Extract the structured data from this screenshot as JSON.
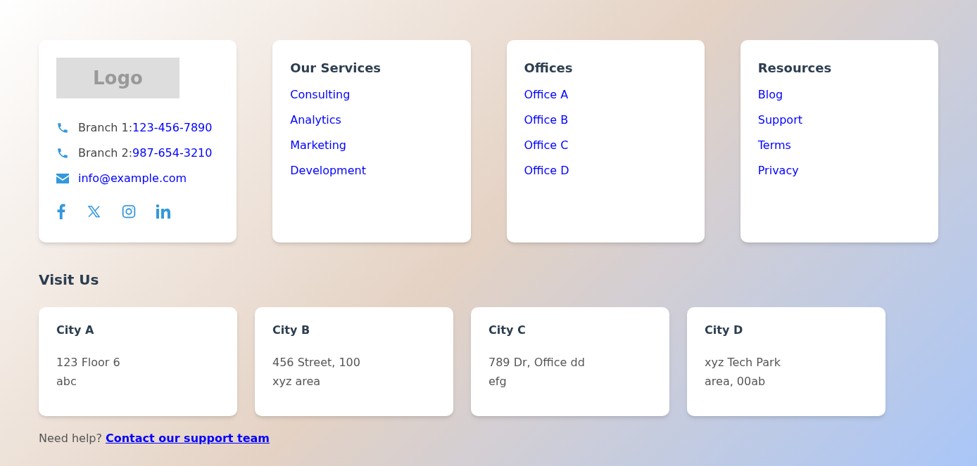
{
  "brand": {
    "logo": "Logo"
  },
  "contacts": [
    {
      "kind": "phone",
      "label": "Branch 1:",
      "value": "123-456-7890"
    },
    {
      "kind": "phone",
      "label": "Branch 2:",
      "value": "987-654-3210"
    },
    {
      "kind": "email",
      "value": "info@example.com"
    }
  ],
  "link_columns": [
    {
      "title": "Our Services",
      "links": [
        "Consulting",
        "Analytics",
        "Marketing",
        "Development"
      ]
    },
    {
      "title": "Offices",
      "links": [
        "Office A",
        "Office B",
        "Office C",
        "Office D"
      ]
    },
    {
      "title": "Resources",
      "links": [
        "Blog",
        "Support",
        "Terms",
        "Privacy"
      ]
    }
  ],
  "visit": {
    "title": "Visit Us",
    "locations": [
      {
        "city": "City A",
        "lines": [
          "123 Floor 6",
          "abc"
        ]
      },
      {
        "city": "City B",
        "lines": [
          "456 Street, 100",
          "xyz area"
        ]
      },
      {
        "city": "City C",
        "lines": [
          "789 Dr, Office dd",
          "efg"
        ]
      },
      {
        "city": "City D",
        "lines": [
          "xyz Tech Park",
          "area, 00ab"
        ]
      }
    ]
  },
  "help": {
    "text": "Need help?",
    "link": "Contact our support team"
  }
}
